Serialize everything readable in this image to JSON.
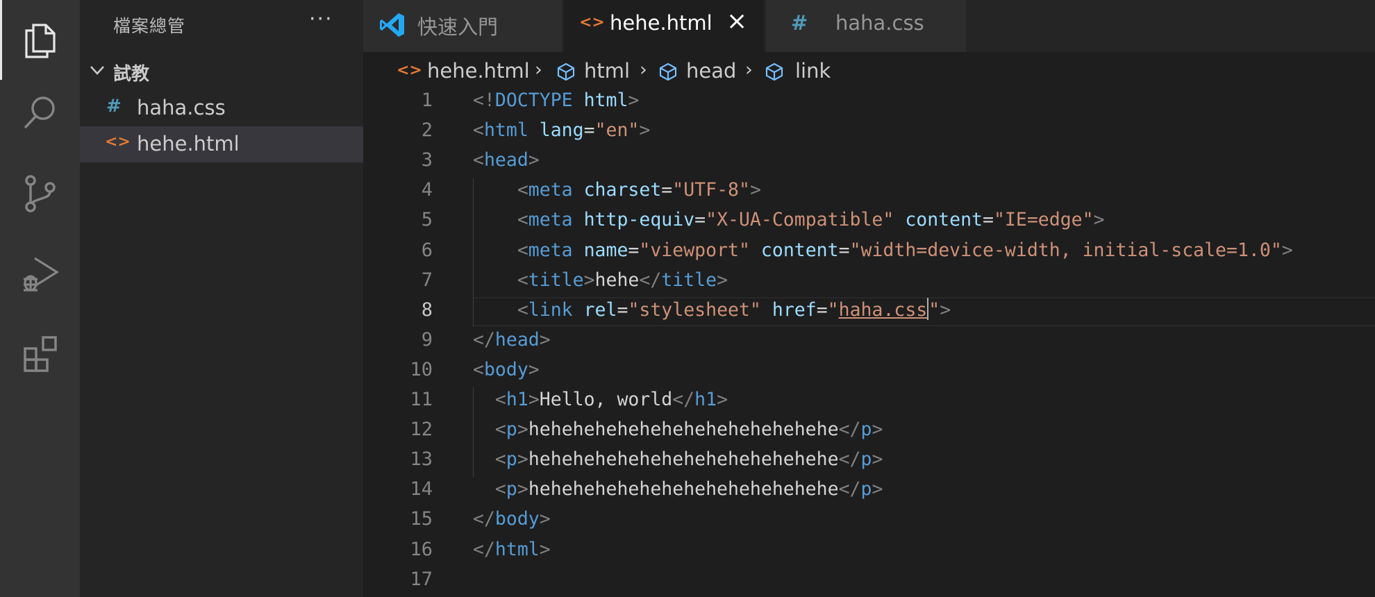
{
  "sidebar": {
    "title": "檔案總管",
    "more": "···",
    "folder": "試教",
    "files": [
      {
        "icon": "#",
        "name": "haha.css",
        "icon_color": "#519aba"
      },
      {
        "icon": "<>",
        "name": "hehe.html",
        "icon_color": "#e37933"
      }
    ]
  },
  "tabs": [
    {
      "label": "快速入門",
      "icon": "vscode-logo-icon"
    },
    {
      "label": "hehe.html",
      "icon": "<>",
      "close": "×"
    },
    {
      "label": "haha.css",
      "icon": "#"
    }
  ],
  "breadcrumb": {
    "file": "hehe.html",
    "items": [
      "html",
      "head",
      "link"
    ],
    "separator": "›"
  },
  "editor": {
    "current_line": 8,
    "line_numbers": [
      "1",
      "2",
      "3",
      "4",
      "5",
      "6",
      "7",
      "8",
      "9",
      "10",
      "11",
      "12",
      "13",
      "14",
      "15",
      "16",
      "17"
    ],
    "lines": [
      "<!DOCTYPE html>",
      "<html lang=\"en\">",
      "<head>",
      "    <meta charset=\"UTF-8\">",
      "    <meta http-equiv=\"X-UA-Compatible\" content=\"IE=edge\">",
      "    <meta name=\"viewport\" content=\"width=device-width, initial-scale=1.0\">",
      "    <title>hehe</title>",
      "    <link rel=\"stylesheet\" href=\"haha.css\">",
      "</head>",
      "<body>",
      "  <h1>Hello, world</h1>",
      "  <p>hehehehehehehehehehehehehehe</p>",
      "  <p>hehehehehehehehehehehehehehe</p>",
      "  <p>hehehehehehehehehehehehehehe</p>",
      "</body>",
      "</html>",
      ""
    ]
  },
  "colors": {
    "tag_bracket": "#808080",
    "tag_name": "#569cd6",
    "attribute": "#9cdcfe",
    "string": "#ce9178",
    "text": "#d4d4d4",
    "html_icon": "#e37933",
    "css_icon": "#519aba",
    "vscode_blue": "#23a9f2"
  },
  "activity_icons": [
    "files-icon",
    "search-icon",
    "source-control-icon",
    "run-debug-icon",
    "extensions-icon"
  ]
}
